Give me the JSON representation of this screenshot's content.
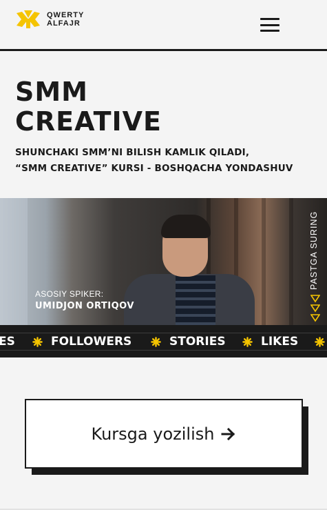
{
  "header": {
    "logo_line1": "QWERTY",
    "logo_line2": "ALFAJR",
    "brand_color": "#f5c400"
  },
  "hero": {
    "title_line1": "SMM",
    "title_line2": "CREATIVE",
    "subtitle_line1": "SHUNCHAKI SMM’NI BILISH KAMLIK QILADI,",
    "subtitle_line2": "“SMM CREATIVE” KURSI - BOSHQACHA YONDASHUV"
  },
  "speaker": {
    "label": "ASOSIY SPIKER:",
    "name": "UMIDJON ORTIQOV"
  },
  "scroll_hint": "PASTGA SURING",
  "ticker": {
    "items": [
      "ES",
      "FOLLOWERS",
      "STORIES",
      "LIKES"
    ],
    "separator_icon": "asterisk-star-icon",
    "accent": "#f5c400"
  },
  "cta": {
    "label": "Kursga yozilish",
    "icon": "arrow-right-icon"
  }
}
